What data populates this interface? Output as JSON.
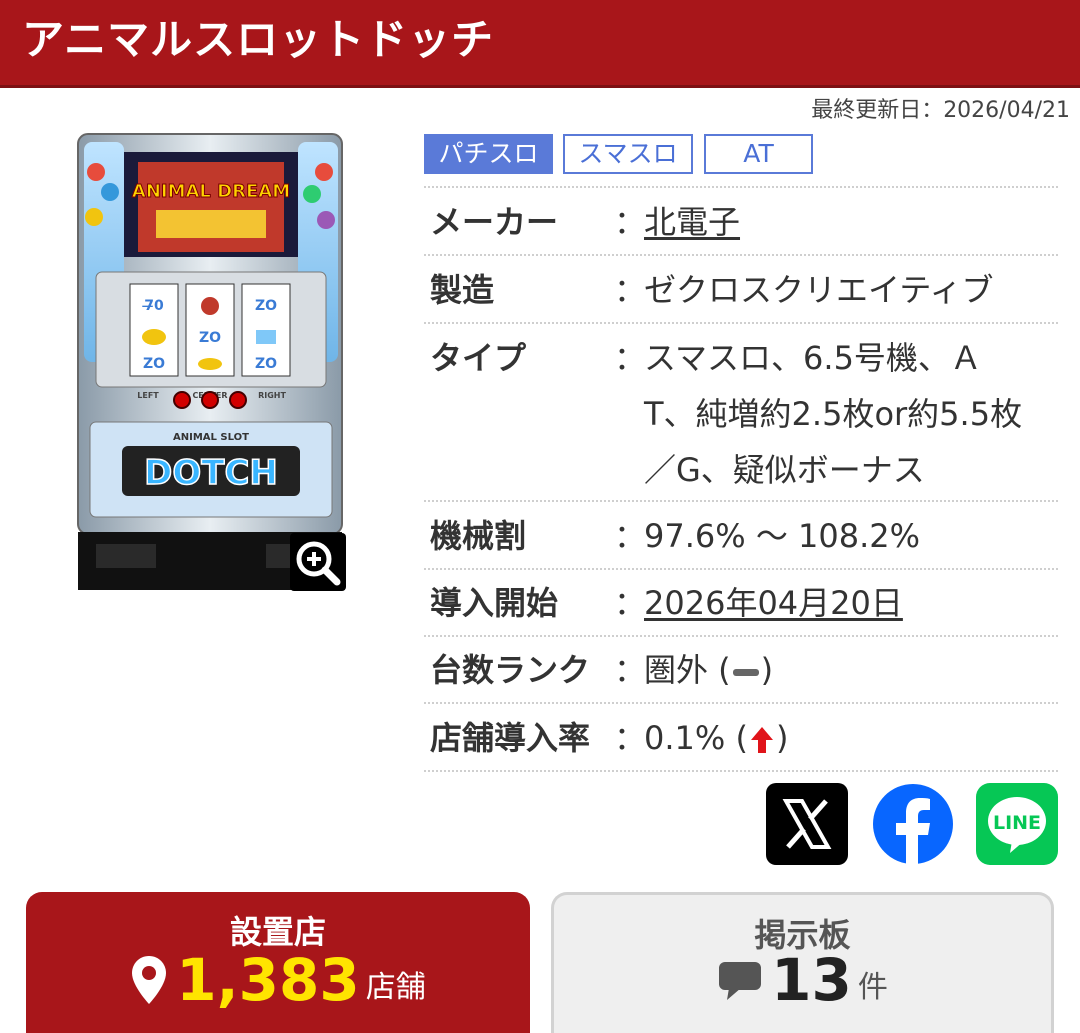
{
  "header": {
    "title": "アニマルスロットドッチ"
  },
  "updated": "最終更新日：2026/04/21",
  "machine": {
    "top_logo": "ANIMAL DREAM",
    "bottom_logo_top": "ANIMAL SLOT",
    "bottom_logo": "DOTCH",
    "reel_labels": [
      "LEFT",
      "CENTER",
      "RIGHT"
    ]
  },
  "tags": [
    "パチスロ",
    "スマスロ",
    "AT"
  ],
  "info": {
    "rows": [
      {
        "label": "メーカー",
        "value": "北電子"
      },
      {
        "label": "製造",
        "value": "ゼクロスクリエイティブ"
      },
      {
        "label": "タイプ",
        "value_lines": [
          "スマスロ、6.5号機、Ａ",
          "T、純増約2.5枚or約5.5枚",
          "／G、疑似ボーナス"
        ]
      },
      {
        "label": "機械割",
        "value": "97.6% 〜 108.2%"
      },
      {
        "label": "導入開始",
        "value": "2026年04月20日"
      },
      {
        "label": "台数ランク",
        "value_prefix": "圏外 (",
        "value_suffix": ")"
      },
      {
        "label": "店舗導入率",
        "value_prefix": "0.1% (",
        "value_suffix": ")"
      }
    ],
    "colon": "："
  },
  "social": {
    "x_icon": "x-logo-icon",
    "facebook_icon": "facebook-logo-icon",
    "line_icon": "line-logo-icon",
    "line_text": "LINE"
  },
  "cards": {
    "shops": {
      "title": "設置店",
      "count": "1,383",
      "unit": "店舗"
    },
    "board": {
      "title": "掲示板",
      "count": "13",
      "unit": "件"
    }
  },
  "colors": {
    "brand_red": "#a8161a",
    "tag_blue": "#5a7ad8",
    "count_yellow": "#ffe400",
    "line_green": "#06c755",
    "facebook_blue": "#0866ff"
  }
}
